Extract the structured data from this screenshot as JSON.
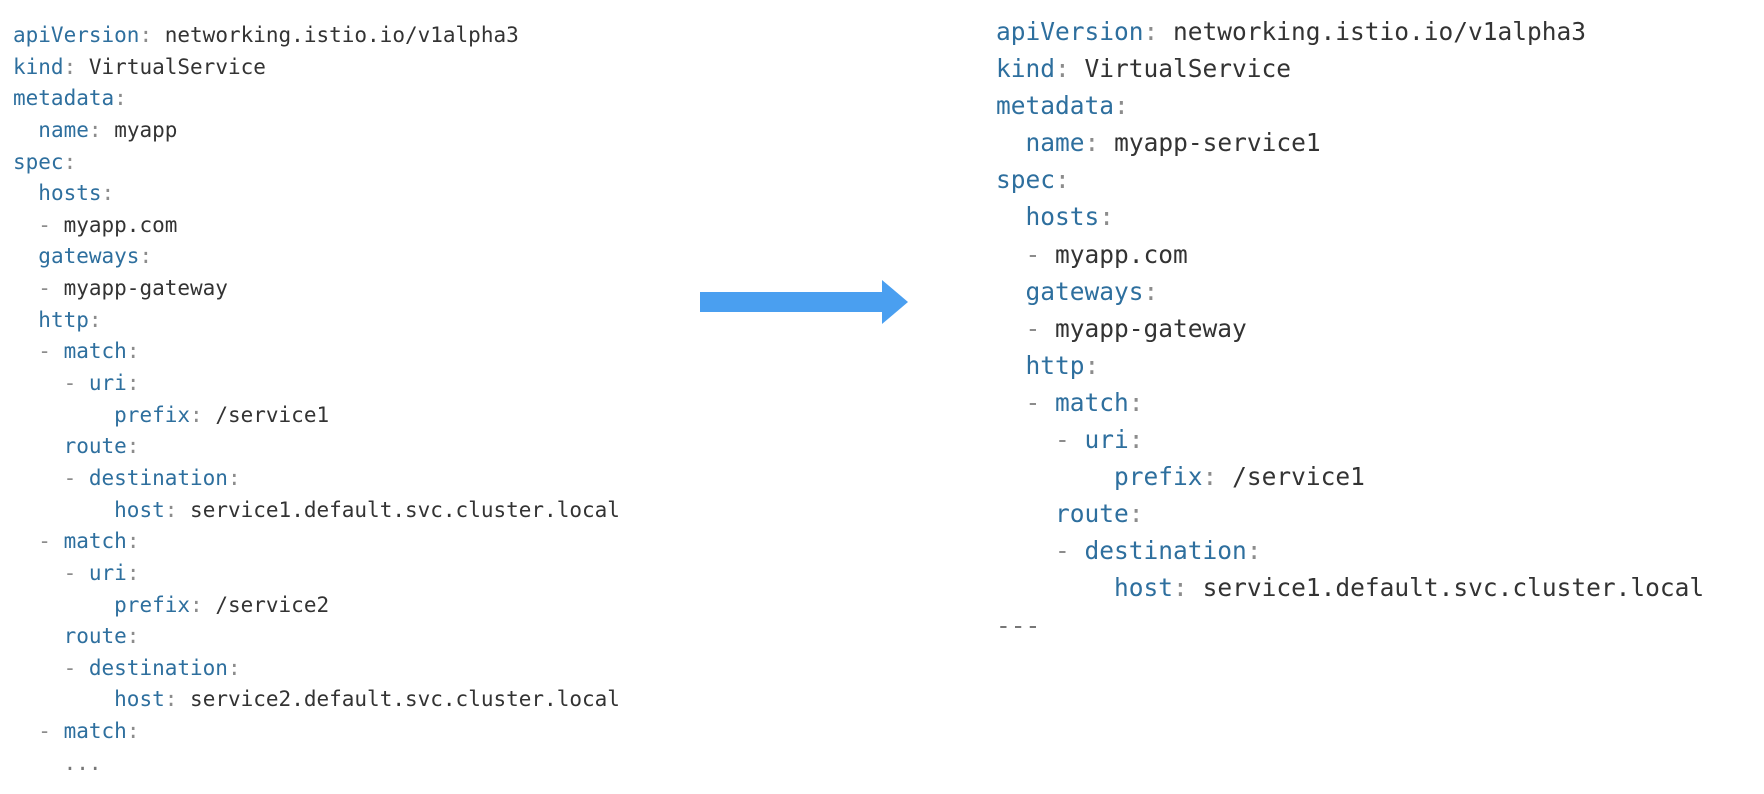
{
  "left_yaml": {
    "lines": [
      {
        "indent": 0,
        "dash": false,
        "key": "apiVersion",
        "value": "networking.istio.io/v1alpha3"
      },
      {
        "indent": 0,
        "dash": false,
        "key": "kind",
        "value": "VirtualService"
      },
      {
        "indent": 0,
        "dash": false,
        "key": "metadata",
        "value": ""
      },
      {
        "indent": 2,
        "dash": false,
        "key": "name",
        "value": "myapp"
      },
      {
        "indent": 0,
        "dash": false,
        "key": "spec",
        "value": ""
      },
      {
        "indent": 2,
        "dash": false,
        "key": "hosts",
        "value": ""
      },
      {
        "indent": 2,
        "dash": true,
        "key": "",
        "value": "myapp.com"
      },
      {
        "indent": 2,
        "dash": false,
        "key": "gateways",
        "value": ""
      },
      {
        "indent": 2,
        "dash": true,
        "key": "",
        "value": "myapp-gateway"
      },
      {
        "indent": 2,
        "dash": false,
        "key": "http",
        "value": ""
      },
      {
        "indent": 2,
        "dash": true,
        "key": "match",
        "value": ""
      },
      {
        "indent": 4,
        "dash": true,
        "key": "uri",
        "value": ""
      },
      {
        "indent": 8,
        "dash": false,
        "key": "prefix",
        "value": "/service1"
      },
      {
        "indent": 4,
        "dash": false,
        "key": "route",
        "value": ""
      },
      {
        "indent": 4,
        "dash": true,
        "key": "destination",
        "value": ""
      },
      {
        "indent": 8,
        "dash": false,
        "key": "host",
        "value": "service1.default.svc.cluster.local"
      },
      {
        "indent": 2,
        "dash": true,
        "key": "match",
        "value": ""
      },
      {
        "indent": 4,
        "dash": true,
        "key": "uri",
        "value": ""
      },
      {
        "indent": 8,
        "dash": false,
        "key": "prefix",
        "value": "/service2"
      },
      {
        "indent": 4,
        "dash": false,
        "key": "route",
        "value": ""
      },
      {
        "indent": 4,
        "dash": true,
        "key": "destination",
        "value": ""
      },
      {
        "indent": 8,
        "dash": false,
        "key": "host",
        "value": "service2.default.svc.cluster.local"
      },
      {
        "indent": 2,
        "dash": true,
        "key": "match",
        "value": ""
      },
      {
        "indent": 4,
        "dash": false,
        "key": "",
        "value": "...",
        "dim": true
      }
    ]
  },
  "right_yaml": {
    "lines": [
      {
        "indent": 0,
        "dash": false,
        "key": "apiVersion",
        "value": "networking.istio.io/v1alpha3"
      },
      {
        "indent": 0,
        "dash": false,
        "key": "kind",
        "value": "VirtualService"
      },
      {
        "indent": 0,
        "dash": false,
        "key": "metadata",
        "value": ""
      },
      {
        "indent": 2,
        "dash": false,
        "key": "name",
        "value": "myapp-service1"
      },
      {
        "indent": 0,
        "dash": false,
        "key": "spec",
        "value": ""
      },
      {
        "indent": 2,
        "dash": false,
        "key": "hosts",
        "value": ""
      },
      {
        "indent": 2,
        "dash": true,
        "key": "",
        "value": "myapp.com"
      },
      {
        "indent": 2,
        "dash": false,
        "key": "gateways",
        "value": ""
      },
      {
        "indent": 2,
        "dash": true,
        "key": "",
        "value": "myapp-gateway"
      },
      {
        "indent": 2,
        "dash": false,
        "key": "http",
        "value": ""
      },
      {
        "indent": 2,
        "dash": true,
        "key": "match",
        "value": ""
      },
      {
        "indent": 4,
        "dash": true,
        "key": "uri",
        "value": ""
      },
      {
        "indent": 8,
        "dash": false,
        "key": "prefix",
        "value": "/service1"
      },
      {
        "indent": 4,
        "dash": false,
        "key": "route",
        "value": ""
      },
      {
        "indent": 4,
        "dash": true,
        "key": "destination",
        "value": ""
      },
      {
        "indent": 8,
        "dash": false,
        "key": "host",
        "value": "service1.default.svc.cluster.local"
      },
      {
        "indent": 0,
        "dash": false,
        "key": "",
        "value": "---",
        "dim": true
      }
    ]
  },
  "arrow": {
    "icon": "right-arrow-icon",
    "color": "#4a9ff0"
  },
  "colors": {
    "key": "#2e6f9e",
    "punctuation": "#8c8c8c",
    "value": "#333333",
    "background": "#ffffff"
  }
}
